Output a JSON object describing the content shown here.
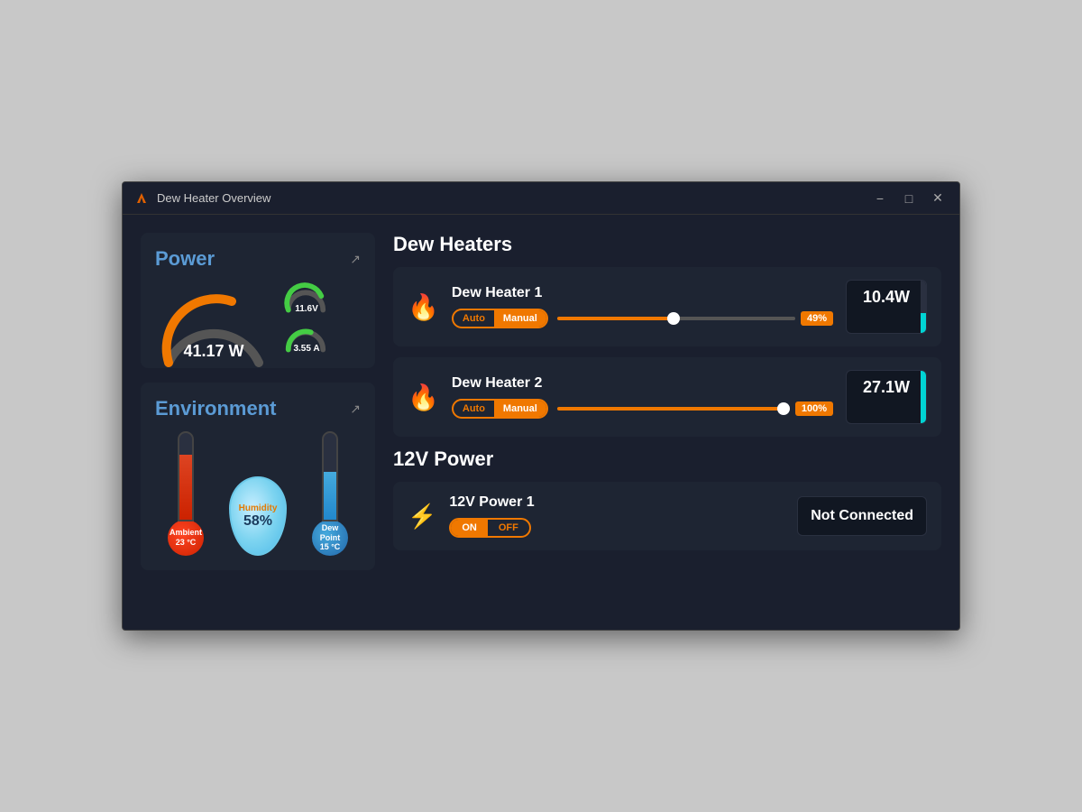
{
  "window": {
    "title": "Dew Heater Overview",
    "icon": "flame-icon"
  },
  "titlebar": {
    "minimize_label": "−",
    "maximize_label": "□",
    "close_label": "✕"
  },
  "left": {
    "power_section": {
      "title": "Power",
      "value": "41.17 W",
      "voltage": "11.6V",
      "current": "3.55 A",
      "external_link": "↗"
    },
    "environment_section": {
      "title": "Environment",
      "external_link": "↗",
      "ambient": {
        "label": "Ambient",
        "value": "23 °C"
      },
      "humidity": {
        "label": "Humidity",
        "value": "58%"
      },
      "dew_point": {
        "label": "Dew Point",
        "value": "15 °C"
      }
    }
  },
  "right": {
    "dew_heaters_title": "Dew Heaters",
    "heaters": [
      {
        "name": "Dew Heater 1",
        "auto_label": "Auto",
        "manual_label": "Manual",
        "active_mode": "manual",
        "slider_value": "49%",
        "slider_percent": 49,
        "power_value": "10.4W",
        "power_percent": 38
      },
      {
        "name": "Dew Heater 2",
        "auto_label": "Auto",
        "manual_label": "Manual",
        "active_mode": "manual",
        "slider_value": "100%",
        "slider_percent": 100,
        "power_value": "27.1W",
        "power_percent": 100
      }
    ],
    "v12_title": "12V Power",
    "v12_items": [
      {
        "name": "12V Power 1",
        "on_label": "ON",
        "off_label": "OFF",
        "active_state": "on",
        "status": "Not Connected"
      }
    ]
  }
}
